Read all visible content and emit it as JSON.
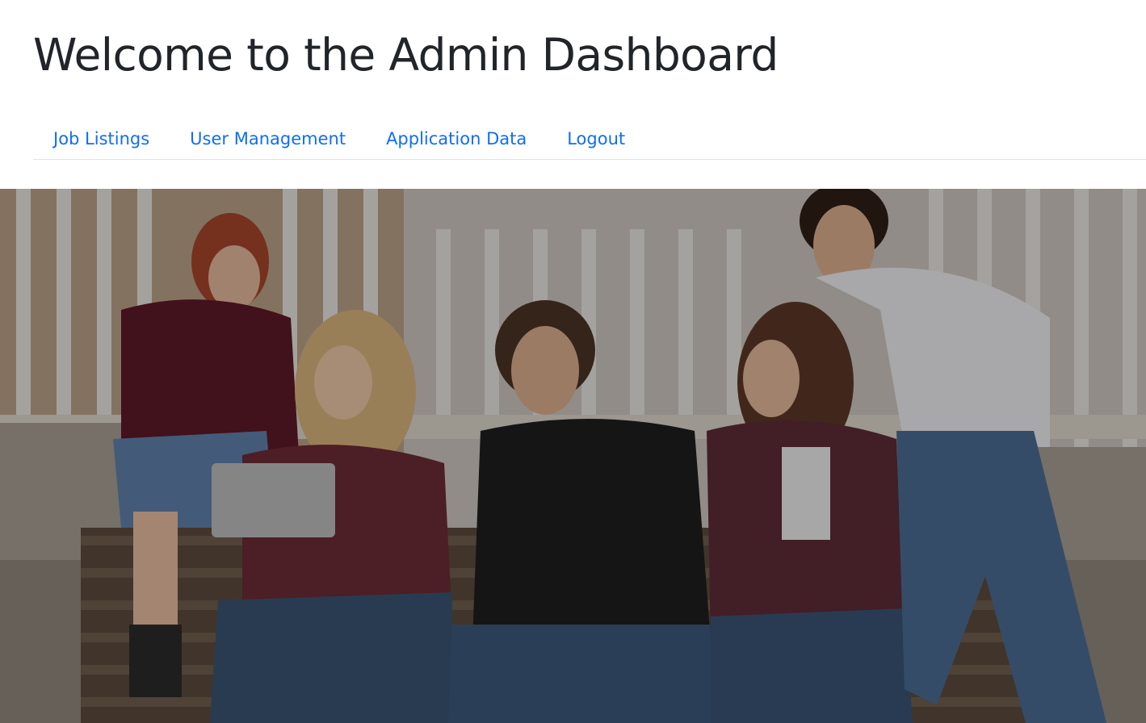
{
  "header": {
    "title": "Welcome to the Admin Dashboard"
  },
  "nav": {
    "items": [
      {
        "label": "Job Listings"
      },
      {
        "label": "User Management"
      },
      {
        "label": "Application Data"
      },
      {
        "label": "Logout"
      }
    ]
  },
  "hero": {
    "image": "group-of-friends-on-bench-photo",
    "overlay_color": "#000000"
  },
  "colors": {
    "link": "#0d6efd",
    "text": "#212529",
    "divider": "#dee2e6"
  }
}
